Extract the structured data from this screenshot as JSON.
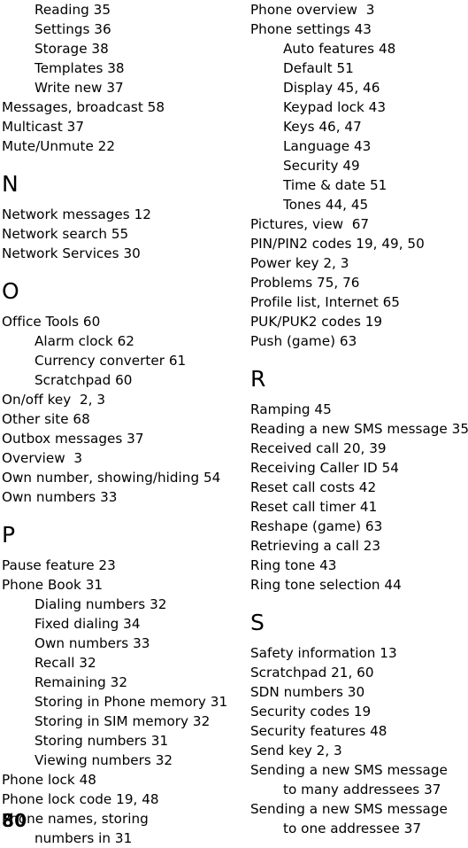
{
  "document": {
    "page_number": "80",
    "type": "index"
  },
  "columns": [
    {
      "name": "left-column",
      "blocks": [
        {
          "kind": "entry",
          "level": 1,
          "text": "Reading 35"
        },
        {
          "kind": "entry",
          "level": 1,
          "text": "Settings 36"
        },
        {
          "kind": "entry",
          "level": 1,
          "text": "Storage 38"
        },
        {
          "kind": "entry",
          "level": 1,
          "text": "Templates 38"
        },
        {
          "kind": "entry",
          "level": 1,
          "text": "Write new 37"
        },
        {
          "kind": "entry",
          "level": 0,
          "text": "Messages, broadcast 58"
        },
        {
          "kind": "entry",
          "level": 0,
          "text": "Multicast 37"
        },
        {
          "kind": "entry",
          "level": 0,
          "text": "Mute/Unmute 22"
        },
        {
          "kind": "heading",
          "level": 0,
          "text": "N"
        },
        {
          "kind": "entry",
          "level": 0,
          "text": "Network messages 12"
        },
        {
          "kind": "entry",
          "level": 0,
          "text": "Network search 55"
        },
        {
          "kind": "entry",
          "level": 0,
          "text": "Network Services 30"
        },
        {
          "kind": "heading",
          "level": 0,
          "text": "O"
        },
        {
          "kind": "entry",
          "level": 0,
          "text": "Office Tools 60"
        },
        {
          "kind": "entry",
          "level": 1,
          "text": "Alarm clock 62"
        },
        {
          "kind": "entry",
          "level": 1,
          "text": "Currency converter 61"
        },
        {
          "kind": "entry",
          "level": 1,
          "text": "Scratchpad 60"
        },
        {
          "kind": "entry",
          "level": 0,
          "text": "On/off key  2, 3"
        },
        {
          "kind": "entry",
          "level": 0,
          "text": "Other site 68"
        },
        {
          "kind": "entry",
          "level": 0,
          "text": "Outbox messages 37"
        },
        {
          "kind": "entry",
          "level": 0,
          "text": "Overview  3"
        },
        {
          "kind": "entry",
          "level": 0,
          "text": "Own number, showing/hiding 54"
        },
        {
          "kind": "entry",
          "level": 0,
          "text": "Own numbers 33"
        },
        {
          "kind": "heading",
          "level": 0,
          "text": "P"
        },
        {
          "kind": "entry",
          "level": 0,
          "text": "Pause feature 23"
        },
        {
          "kind": "entry",
          "level": 0,
          "text": "Phone Book 31"
        },
        {
          "kind": "entry",
          "level": 1,
          "text": "Dialing numbers 32"
        },
        {
          "kind": "entry",
          "level": 1,
          "text": "Fixed dialing 34"
        },
        {
          "kind": "entry",
          "level": 1,
          "text": "Own numbers 33"
        },
        {
          "kind": "entry",
          "level": 1,
          "text": "Recall 32"
        },
        {
          "kind": "entry",
          "level": 1,
          "text": "Remaining 32"
        },
        {
          "kind": "entry",
          "level": 1,
          "text": "Storing in Phone memory 31"
        },
        {
          "kind": "entry",
          "level": 1,
          "text": "Storing in SIM memory 32"
        },
        {
          "kind": "entry",
          "level": 1,
          "text": "Storing numbers 31"
        },
        {
          "kind": "entry",
          "level": 1,
          "text": "Viewing numbers 32"
        },
        {
          "kind": "entry",
          "level": 0,
          "text": "Phone lock 48"
        },
        {
          "kind": "entry",
          "level": 0,
          "text": "Phone lock code 19, 48"
        },
        {
          "kind": "entry",
          "level": 0,
          "text": "Phone names, storing"
        },
        {
          "kind": "entry",
          "level": 1,
          "text": "numbers in 31"
        }
      ]
    },
    {
      "name": "right-column",
      "blocks": [
        {
          "kind": "entry",
          "level": 0,
          "text": "Phone overview  3"
        },
        {
          "kind": "entry",
          "level": 0,
          "text": "Phone settings 43"
        },
        {
          "kind": "entry",
          "level": 1,
          "text": "Auto features 48"
        },
        {
          "kind": "entry",
          "level": 1,
          "text": "Default 51"
        },
        {
          "kind": "entry",
          "level": 1,
          "text": "Display 45, 46"
        },
        {
          "kind": "entry",
          "level": 1,
          "text": "Keypad lock 43"
        },
        {
          "kind": "entry",
          "level": 1,
          "text": "Keys 46, 47"
        },
        {
          "kind": "entry",
          "level": 1,
          "text": "Language 43"
        },
        {
          "kind": "entry",
          "level": 1,
          "text": "Security 49"
        },
        {
          "kind": "entry",
          "level": 1,
          "text": "Time & date 51"
        },
        {
          "kind": "entry",
          "level": 1,
          "text": "Tones 44, 45"
        },
        {
          "kind": "entry",
          "level": 0,
          "text": "Pictures, view  67"
        },
        {
          "kind": "entry",
          "level": 0,
          "text": "PIN/PIN2 codes 19, 49, 50"
        },
        {
          "kind": "entry",
          "level": 0,
          "text": "Power key 2, 3"
        },
        {
          "kind": "entry",
          "level": 0,
          "text": "Problems 75, 76"
        },
        {
          "kind": "entry",
          "level": 0,
          "text": "Profile list, Internet 65"
        },
        {
          "kind": "entry",
          "level": 0,
          "text": "PUK/PUK2 codes 19"
        },
        {
          "kind": "entry",
          "level": 0,
          "text": "Push (game) 63"
        },
        {
          "kind": "heading",
          "level": 0,
          "text": "R"
        },
        {
          "kind": "entry",
          "level": 0,
          "text": "Ramping 45"
        },
        {
          "kind": "entry",
          "level": 0,
          "text": "Reading a new SMS message 35"
        },
        {
          "kind": "entry",
          "level": 0,
          "text": "Received call 20, 39"
        },
        {
          "kind": "entry",
          "level": 0,
          "text": "Receiving Caller ID 54"
        },
        {
          "kind": "entry",
          "level": 0,
          "text": "Reset call costs 42"
        },
        {
          "kind": "entry",
          "level": 0,
          "text": "Reset call timer 41"
        },
        {
          "kind": "entry",
          "level": 0,
          "text": "Reshape (game) 63"
        },
        {
          "kind": "entry",
          "level": 0,
          "text": "Retrieving a call 23"
        },
        {
          "kind": "entry",
          "level": 0,
          "text": "Ring tone 43"
        },
        {
          "kind": "entry",
          "level": 0,
          "text": "Ring tone selection 44"
        },
        {
          "kind": "heading",
          "level": 0,
          "text": "S"
        },
        {
          "kind": "entry",
          "level": 0,
          "text": "Safety information 13"
        },
        {
          "kind": "entry",
          "level": 0,
          "text": "Scratchpad 21, 60"
        },
        {
          "kind": "entry",
          "level": 0,
          "text": "SDN numbers 30"
        },
        {
          "kind": "entry",
          "level": 0,
          "text": "Security codes 19"
        },
        {
          "kind": "entry",
          "level": 0,
          "text": "Security features 48"
        },
        {
          "kind": "entry",
          "level": 0,
          "text": "Send key 2, 3"
        },
        {
          "kind": "entry",
          "level": 0,
          "text": "Sending a new SMS message"
        },
        {
          "kind": "entry",
          "level": 1,
          "text": "to many addressees 37"
        },
        {
          "kind": "entry",
          "level": 0,
          "text": "Sending a new SMS message"
        },
        {
          "kind": "entry",
          "level": 1,
          "text": "to one addressee 37"
        }
      ]
    }
  ]
}
